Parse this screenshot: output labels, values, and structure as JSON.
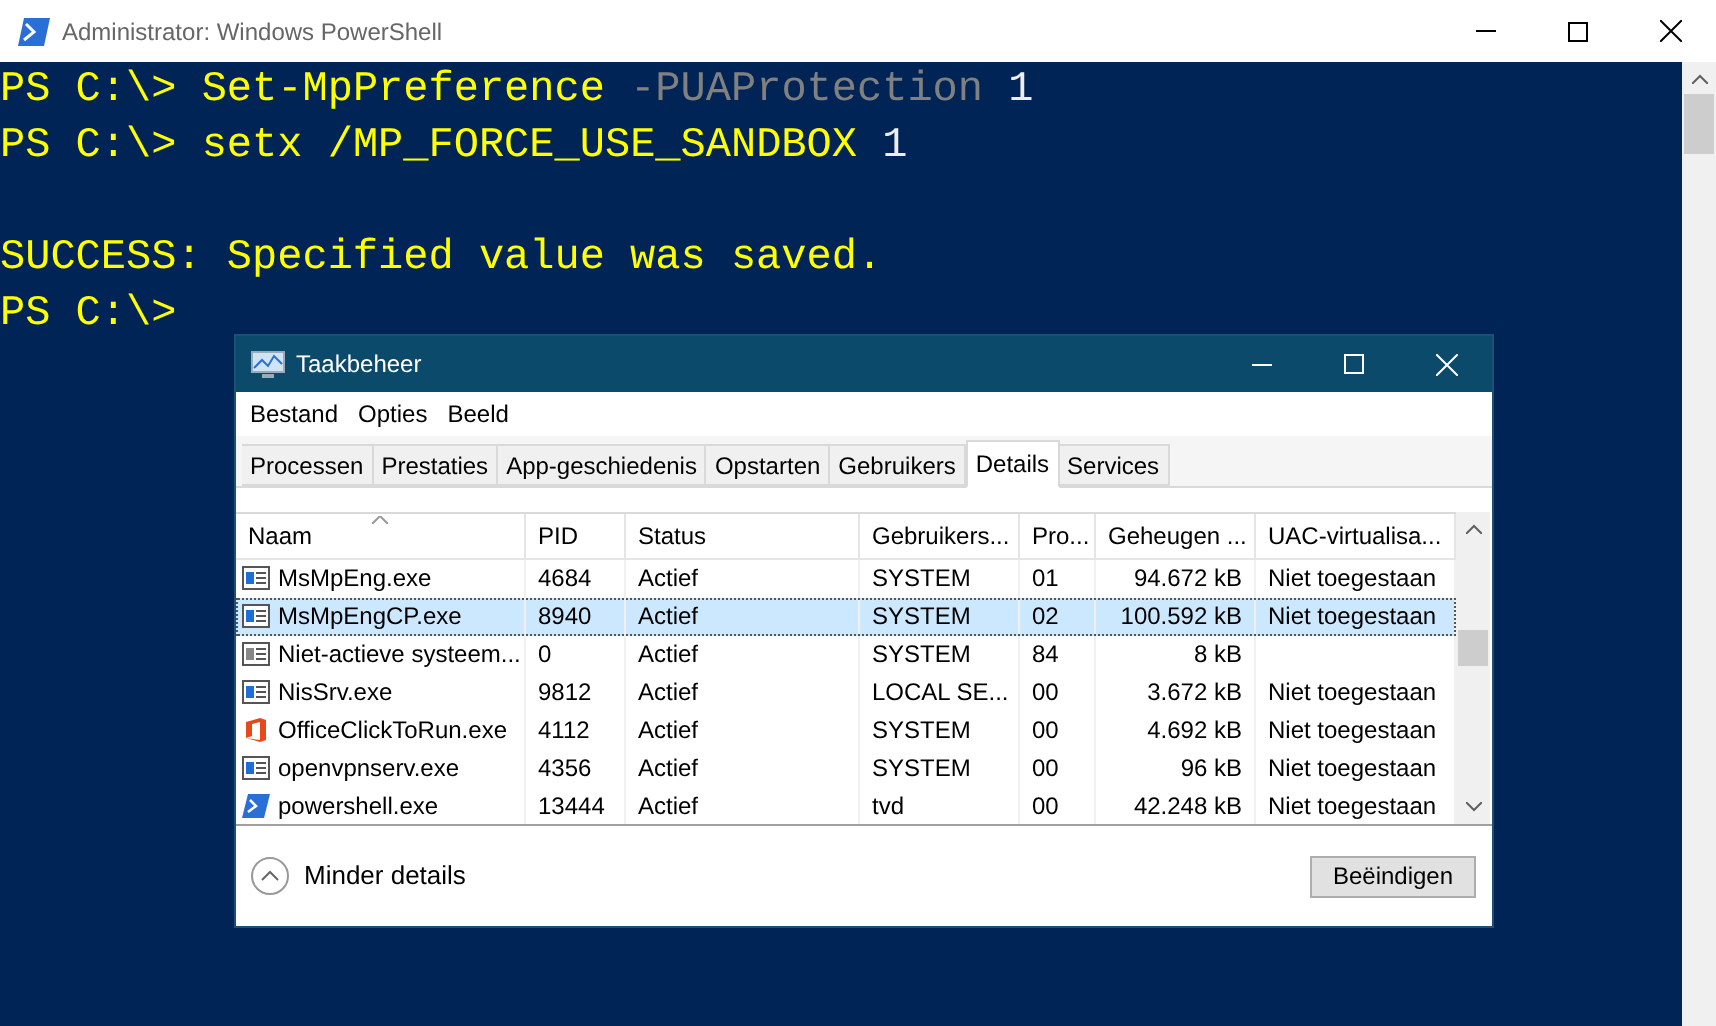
{
  "window": {
    "title": "Administrator: Windows PowerShell"
  },
  "console": {
    "lines": [
      {
        "segments": [
          {
            "kind": "prompt",
            "text": "PS C:\\> "
          },
          {
            "kind": "command",
            "text": "Set-MpPreference "
          },
          {
            "kind": "parameter",
            "text": "-PUAProtection "
          },
          {
            "kind": "argument",
            "text": "1"
          }
        ]
      },
      {
        "segments": [
          {
            "kind": "prompt",
            "text": "PS C:\\> "
          },
          {
            "kind": "command",
            "text": "setx /MP_FORCE_USE_SANDBOX "
          },
          {
            "kind": "argument",
            "text": "1"
          }
        ]
      },
      {
        "kind": "blank"
      },
      {
        "segments": [
          {
            "kind": "output",
            "text": "SUCCESS: Specified value was saved."
          }
        ]
      },
      {
        "segments": [
          {
            "kind": "prompt",
            "text": "PS C:\\>"
          }
        ]
      }
    ]
  },
  "task_manager": {
    "title": "Taakbeheer",
    "menu": [
      "Bestand",
      "Opties",
      "Beeld"
    ],
    "tabs": [
      {
        "label": "Processen",
        "selected": false
      },
      {
        "label": "Prestaties",
        "selected": false
      },
      {
        "label": "App-geschiedenis",
        "selected": false
      },
      {
        "label": "Opstarten",
        "selected": false
      },
      {
        "label": "Gebruikers",
        "selected": false
      },
      {
        "label": "Details",
        "selected": true
      },
      {
        "label": "Services",
        "selected": false
      }
    ],
    "table": {
      "columns": [
        "Naam",
        "PID",
        "Status",
        "Gebruikers...",
        "Pro...",
        "Geheugen ...",
        "UAC-virtualisa..."
      ],
      "rows": [
        {
          "kind": "service",
          "selected": false,
          "cells": [
            "MsMpEng.exe",
            "4684",
            "Actief",
            "SYSTEM",
            "01",
            "94.672 kB",
            "Niet toegestaan"
          ]
        },
        {
          "kind": "service",
          "selected": true,
          "cells": [
            "MsMpEngCP.exe",
            "8940",
            "Actief",
            "SYSTEM",
            "02",
            "100.592 kB",
            "Niet toegestaan"
          ]
        },
        {
          "kind": "idle",
          "selected": false,
          "cells": [
            "Niet-actieve systeem...",
            "0",
            "Actief",
            "SYSTEM",
            "84",
            "8 kB",
            ""
          ]
        },
        {
          "kind": "service",
          "selected": false,
          "cells": [
            "NisSrv.exe",
            "9812",
            "Actief",
            "LOCAL SE...",
            "00",
            "3.672 kB",
            "Niet toegestaan"
          ]
        },
        {
          "kind": "office",
          "selected": false,
          "cells": [
            "OfficeClickToRun.exe",
            "4112",
            "Actief",
            "SYSTEM",
            "00",
            "4.692 kB",
            "Niet toegestaan"
          ]
        },
        {
          "kind": "service",
          "selected": false,
          "cells": [
            "openvpnserv.exe",
            "4356",
            "Actief",
            "SYSTEM",
            "00",
            "96 kB",
            "Niet toegestaan"
          ]
        },
        {
          "kind": "shell",
          "selected": false,
          "cells": [
            "powershell.exe",
            "13444",
            "Actief",
            "tvd",
            "00",
            "42.248 kB",
            "Niet toegestaan"
          ]
        }
      ]
    },
    "footer": {
      "toggle": "Minder details",
      "button": "Beëindigen"
    }
  }
}
